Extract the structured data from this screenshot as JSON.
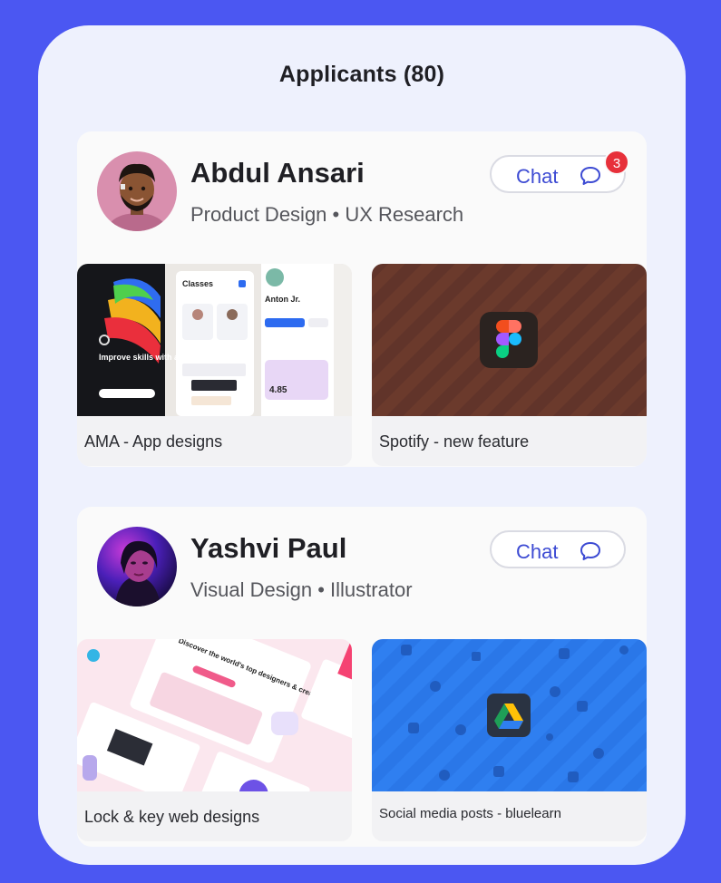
{
  "header": {
    "title": "Applicants (80)"
  },
  "applicants": [
    {
      "name": "Abdul Ansari",
      "skills": "Product Design • UX Research",
      "chat_label": "Chat",
      "unread": "3",
      "projects": [
        {
          "caption": "AMA - App designs",
          "thumb": {
            "tagline": "Improve skills with ama.",
            "heading": "Classes",
            "profile": "Anton Jr.",
            "stat": "4.85"
          }
        },
        {
          "caption": "Spotify - new feature",
          "icon": "figma-icon"
        }
      ]
    },
    {
      "name": "Yashvi Paul",
      "skills": "Visual Design • Illustrator",
      "chat_label": "Chat",
      "projects": [
        {
          "caption": "Lock & key web designs",
          "thumb": {
            "headline": "Discover the world's top designers & creatives"
          }
        },
        {
          "caption": "Social media posts - bluelearn",
          "icon": "google-drive-icon"
        }
      ]
    }
  ],
  "colors": {
    "background": "#4b57f2",
    "panel": "#eef1fd",
    "accent": "#3d4bd3",
    "badge": "#e7303a"
  }
}
